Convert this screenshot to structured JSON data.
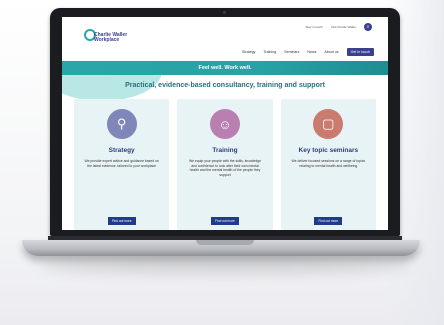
{
  "site": {
    "logo": {
      "line1": "Charlie Waller",
      "line2": "Workplace"
    },
    "util_links": [
      "Stay in touch",
      "Visit Charlie Waller"
    ],
    "nav": [
      "Strategy",
      "Training",
      "Seminars",
      "News",
      "About us",
      "Get in touch"
    ],
    "banner": "Feel well. Work well.",
    "headline": "Practical, evidence-based consultancy, training and support",
    "cards": [
      {
        "title": "Strategy",
        "body": "We provide expert advice and guidance based on the latest evidence, tailored to your workplace",
        "button": "Find out more",
        "icon_color": "#7f86b8",
        "icon": "search-person-icon"
      },
      {
        "title": "Training",
        "body": "We equip your people with the skills, knowledge and confidence to look after their own mental health and the mental health of the people they support",
        "button": "Find out more",
        "icon_color": "#b87fb0",
        "icon": "group-icon"
      },
      {
        "title": "Key topic seminars",
        "body": "We deliver focused sessions on a range of topics relating to mental health and wellbeing",
        "button": "Find out more",
        "icon_color": "#c97b70",
        "icon": "laptop-icon"
      }
    ]
  },
  "colors": {
    "brand_navy": "#3b3f8f",
    "brand_teal": "#2aa6a8",
    "button_blue": "#1f3c88"
  }
}
